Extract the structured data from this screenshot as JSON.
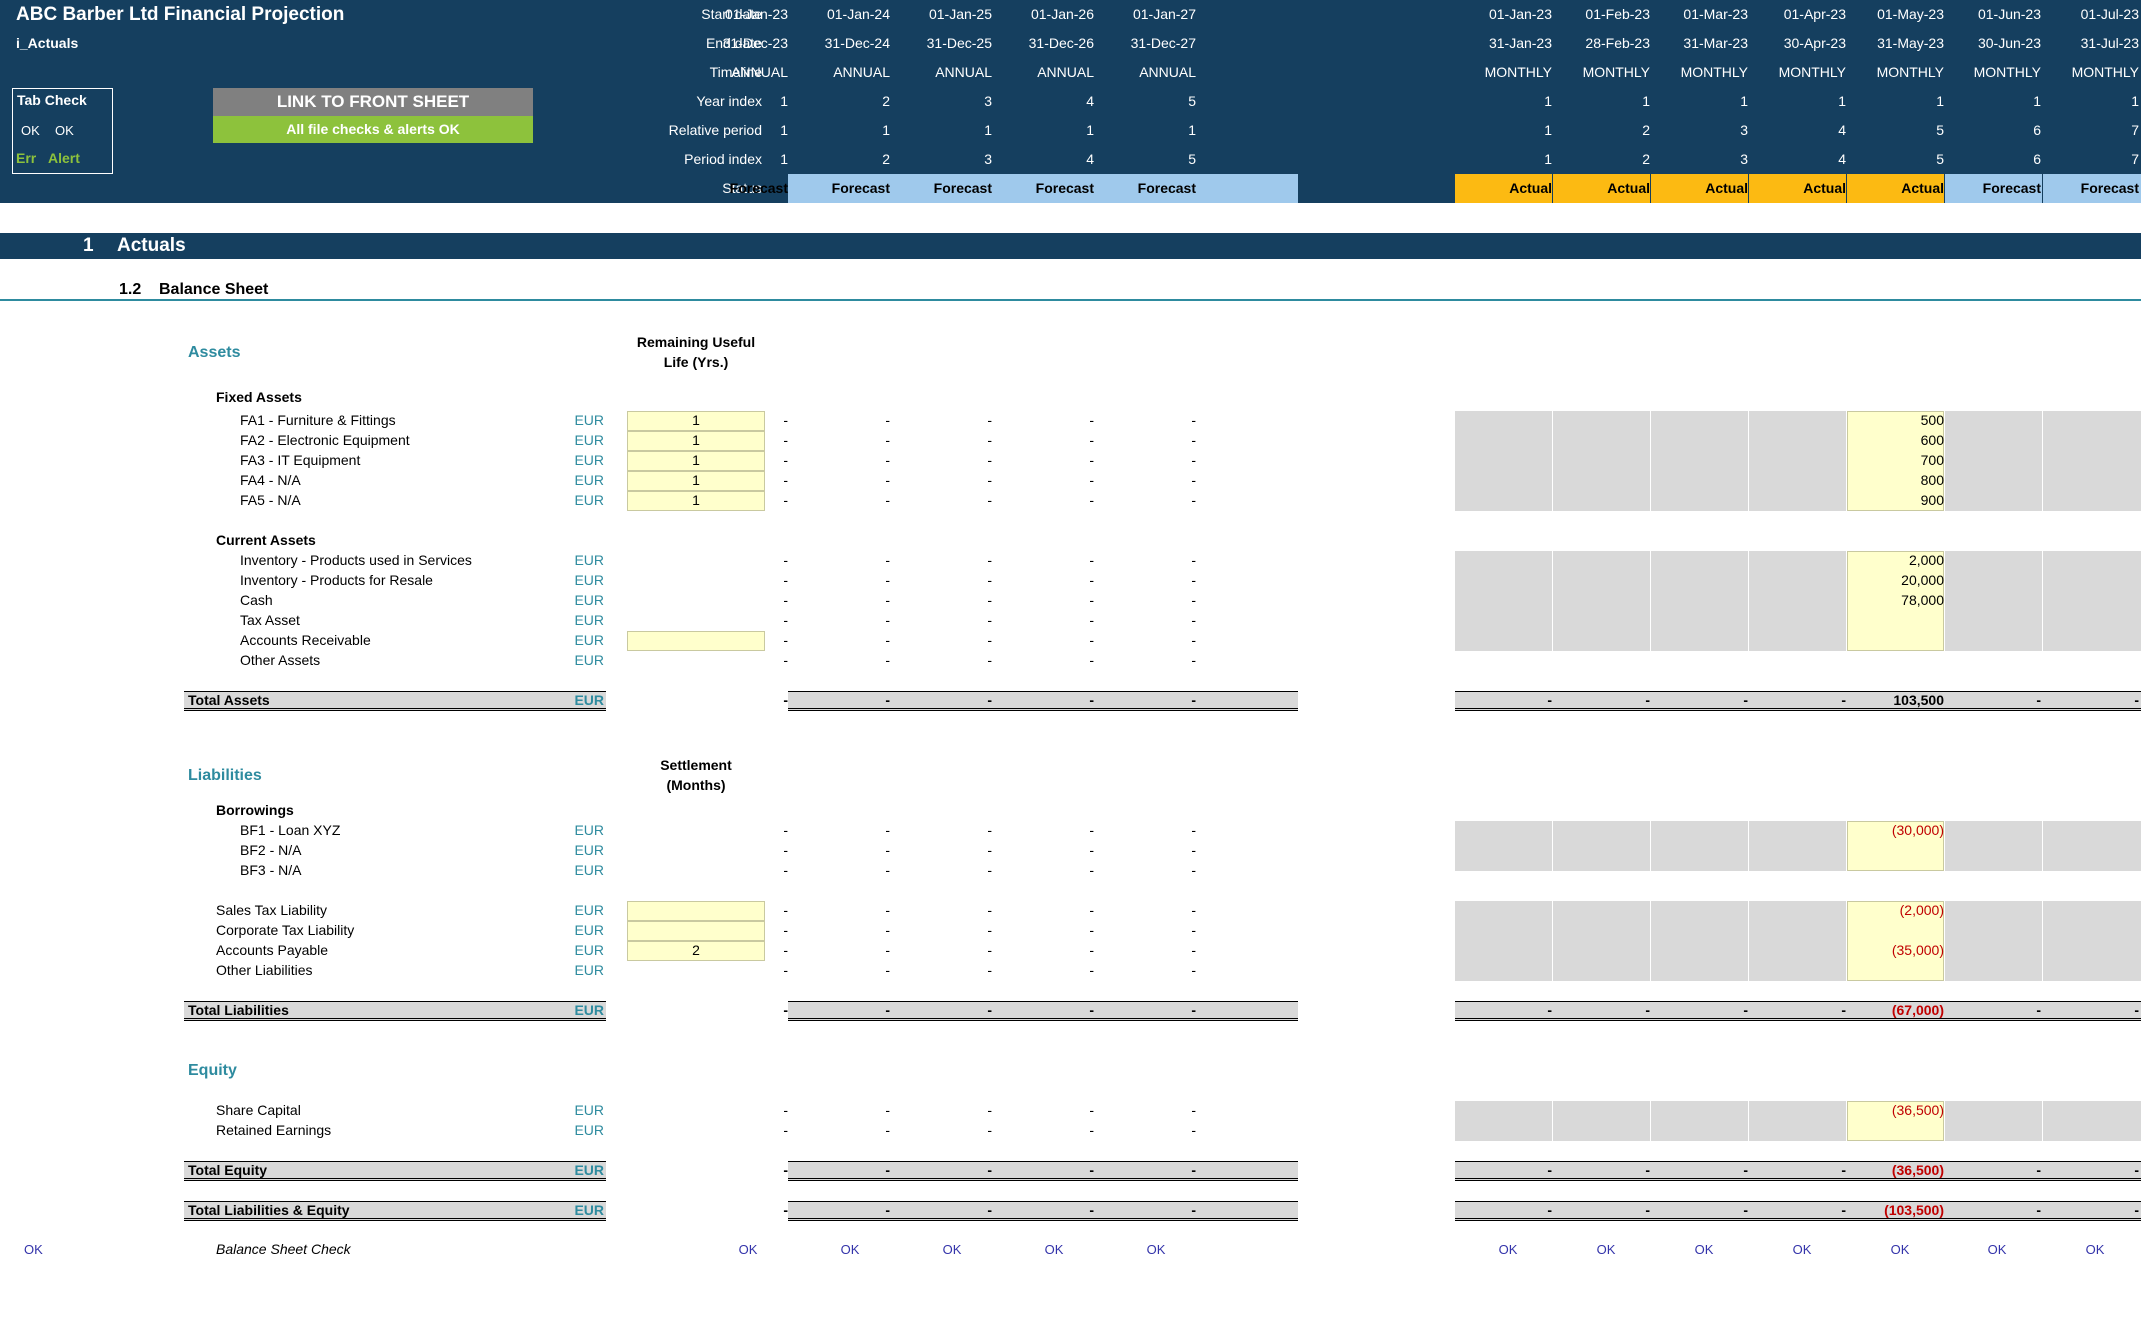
{
  "colors": {
    "header_bg": "#153f5f",
    "section_bg": "#153f5f",
    "forecast_bg": "#9fc9ec",
    "actual_bg": "#fcba12",
    "input_bg": "#ffffcc",
    "grey_cell": "#d9d9d9",
    "green_button": "#8dc23c",
    "grey_button": "#808080",
    "teal_text": "#2e8b9f",
    "neg_red": "#c00000",
    "ok_blue": "#3333aa"
  },
  "header": {
    "title": "ABC Barber Ltd Financial Projection",
    "sheet_name": "i_Actuals",
    "tab_check": {
      "title": "Tab Check",
      "ok1": "OK",
      "ok2": "OK",
      "err": "Err",
      "alert": "Alert"
    },
    "link_button": "LINK TO FRONT SHEET",
    "checks_banner": "All file checks & alerts OK",
    "row_labels": [
      "Start date",
      "End date",
      "Timeline",
      "Year index",
      "Relative period",
      "Period index",
      "Status"
    ],
    "annual": [
      {
        "start": "01-Jan-23",
        "end": "31-Dec-23",
        "timeline": "ANNUAL",
        "year": "1",
        "rel": "1",
        "period": "1",
        "status": "Forecast"
      },
      {
        "start": "01-Jan-24",
        "end": "31-Dec-24",
        "timeline": "ANNUAL",
        "year": "2",
        "rel": "1",
        "period": "2",
        "status": "Forecast"
      },
      {
        "start": "01-Jan-25",
        "end": "31-Dec-25",
        "timeline": "ANNUAL",
        "year": "3",
        "rel": "1",
        "period": "3",
        "status": "Forecast"
      },
      {
        "start": "01-Jan-26",
        "end": "31-Dec-26",
        "timeline": "ANNUAL",
        "year": "4",
        "rel": "1",
        "period": "4",
        "status": "Forecast"
      },
      {
        "start": "01-Jan-27",
        "end": "31-Dec-27",
        "timeline": "ANNUAL",
        "year": "5",
        "rel": "1",
        "period": "5",
        "status": "Forecast"
      }
    ],
    "monthly": [
      {
        "start": "01-Jan-23",
        "end": "31-Jan-23",
        "timeline": "MONTHLY",
        "year": "1",
        "rel": "1",
        "period": "1",
        "status": "Actual"
      },
      {
        "start": "01-Feb-23",
        "end": "28-Feb-23",
        "timeline": "MONTHLY",
        "year": "1",
        "rel": "2",
        "period": "2",
        "status": "Actual"
      },
      {
        "start": "01-Mar-23",
        "end": "31-Mar-23",
        "timeline": "MONTHLY",
        "year": "1",
        "rel": "3",
        "period": "3",
        "status": "Actual"
      },
      {
        "start": "01-Apr-23",
        "end": "30-Apr-23",
        "timeline": "MONTHLY",
        "year": "1",
        "rel": "4",
        "period": "4",
        "status": "Actual"
      },
      {
        "start": "01-May-23",
        "end": "31-May-23",
        "timeline": "MONTHLY",
        "year": "1",
        "rel": "5",
        "period": "5",
        "status": "Actual"
      },
      {
        "start": "01-Jun-23",
        "end": "30-Jun-23",
        "timeline": "MONTHLY",
        "year": "1",
        "rel": "6",
        "period": "6",
        "status": "Forecast"
      },
      {
        "start": "01-Jul-23",
        "end": "31-Jul-23",
        "timeline": "MONTHLY",
        "year": "1",
        "rel": "7",
        "period": "7",
        "status": "Forecast"
      }
    ]
  },
  "section": {
    "number": "1",
    "title": "Actuals",
    "sub_number": "1.2",
    "sub_title": "Balance Sheet"
  },
  "assets": {
    "title": "Assets",
    "col_header": [
      "Remaining Useful",
      "Life (Yrs.)"
    ],
    "fixed_title": "Fixed Assets",
    "current_title": "Current Assets",
    "fixed": [
      {
        "label": "FA1 - Furniture & Fittings",
        "unit": "EUR",
        "input": "1",
        "annual": [
          "-",
          "-",
          "-",
          "-",
          "-"
        ],
        "monthly": [
          "",
          "",
          "",
          "",
          "500",
          "",
          ""
        ]
      },
      {
        "label": "FA2 - Electronic Equipment",
        "unit": "EUR",
        "input": "1",
        "annual": [
          "-",
          "-",
          "-",
          "-",
          "-"
        ],
        "monthly": [
          "",
          "",
          "",
          "",
          "600",
          "",
          ""
        ]
      },
      {
        "label": "FA3 - IT Equipment",
        "unit": "EUR",
        "input": "1",
        "annual": [
          "-",
          "-",
          "-",
          "-",
          "-"
        ],
        "monthly": [
          "",
          "",
          "",
          "",
          "700",
          "",
          ""
        ]
      },
      {
        "label": "FA4 - N/A",
        "unit": "EUR",
        "input": "1",
        "annual": [
          "-",
          "-",
          "-",
          "-",
          "-"
        ],
        "monthly": [
          "",
          "",
          "",
          "",
          "800",
          "",
          ""
        ]
      },
      {
        "label": "FA5 - N/A",
        "unit": "EUR",
        "input": "1",
        "annual": [
          "-",
          "-",
          "-",
          "-",
          "-"
        ],
        "monthly": [
          "",
          "",
          "",
          "",
          "900",
          "",
          ""
        ]
      }
    ],
    "current": [
      {
        "label": "Inventory - Products used in Services",
        "unit": "EUR",
        "annual": [
          "-",
          "-",
          "-",
          "-",
          "-"
        ],
        "monthly": [
          "",
          "",
          "",
          "",
          "2,000",
          "",
          ""
        ]
      },
      {
        "label": "Inventory - Products for Resale",
        "unit": "EUR",
        "annual": [
          "-",
          "-",
          "-",
          "-",
          "-"
        ],
        "monthly": [
          "",
          "",
          "",
          "",
          "20,000",
          "",
          ""
        ]
      },
      {
        "label": "Cash",
        "unit": "EUR",
        "annual": [
          "-",
          "-",
          "-",
          "-",
          "-"
        ],
        "monthly": [
          "",
          "",
          "",
          "",
          "78,000",
          "",
          ""
        ]
      },
      {
        "label": "Tax Asset",
        "unit": "EUR",
        "annual": [
          "-",
          "-",
          "-",
          "-",
          "-"
        ],
        "monthly": [
          "",
          "",
          "",
          "",
          "",
          "",
          ""
        ]
      },
      {
        "label": "Accounts Receivable",
        "unit": "EUR",
        "input": "",
        "annual": [
          "-",
          "-",
          "-",
          "-",
          "-"
        ],
        "monthly": [
          "",
          "",
          "",
          "",
          "",
          "",
          ""
        ]
      },
      {
        "label": "Other Assets",
        "unit": "EUR",
        "annual": [
          "-",
          "-",
          "-",
          "-",
          "-"
        ],
        "monthly": [
          "",
          "",
          "",
          "",
          "",
          "",
          ""
        ]
      }
    ],
    "total": {
      "label": "Total Assets",
      "unit": "EUR",
      "annual": [
        "-",
        "-",
        "-",
        "-",
        "-"
      ],
      "monthly": [
        "-",
        "-",
        "-",
        "-",
        "103,500",
        "-",
        "-"
      ]
    }
  },
  "liabilities": {
    "title": "Liabilities",
    "col_header": [
      "Settlement",
      "(Months)"
    ],
    "borrowings_title": "Borrowings",
    "borrowings": [
      {
        "label": "BF1 - Loan XYZ",
        "unit": "EUR",
        "annual": [
          "-",
          "-",
          "-",
          "-",
          "-"
        ],
        "monthly": [
          "",
          "",
          "",
          "",
          "(30,000)",
          "",
          ""
        ]
      },
      {
        "label": "BF2 - N/A",
        "unit": "EUR",
        "annual": [
          "-",
          "-",
          "-",
          "-",
          "-"
        ],
        "monthly": [
          "",
          "",
          "",
          "",
          "",
          "",
          ""
        ]
      },
      {
        "label": "BF3 - N/A",
        "unit": "EUR",
        "annual": [
          "-",
          "-",
          "-",
          "-",
          "-"
        ],
        "monthly": [
          "",
          "",
          "",
          "",
          "",
          "",
          ""
        ]
      }
    ],
    "other": [
      {
        "label": "Sales Tax Liability",
        "unit": "EUR",
        "input": "",
        "annual": [
          "-",
          "-",
          "-",
          "-",
          "-"
        ],
        "monthly": [
          "",
          "",
          "",
          "",
          "(2,000)",
          "",
          ""
        ]
      },
      {
        "label": "Corporate Tax Liability",
        "unit": "EUR",
        "input": "",
        "annual": [
          "-",
          "-",
          "-",
          "-",
          "-"
        ],
        "monthly": [
          "",
          "",
          "",
          "",
          "",
          "",
          ""
        ]
      },
      {
        "label": "Accounts Payable",
        "unit": "EUR",
        "input": "2",
        "annual": [
          "-",
          "-",
          "-",
          "-",
          "-"
        ],
        "monthly": [
          "",
          "",
          "",
          "",
          "(35,000)",
          "",
          ""
        ]
      },
      {
        "label": "Other Liabilities",
        "unit": "EUR",
        "annual": [
          "-",
          "-",
          "-",
          "-",
          "-"
        ],
        "monthly": [
          "",
          "",
          "",
          "",
          "",
          "",
          ""
        ]
      }
    ],
    "total": {
      "label": "Total Liabilities",
      "unit": "EUR",
      "annual": [
        "-",
        "-",
        "-",
        "-",
        "-"
      ],
      "monthly": [
        "-",
        "-",
        "-",
        "-",
        "(67,000)",
        "-",
        "-"
      ]
    }
  },
  "equity": {
    "title": "Equity",
    "rows": [
      {
        "label": "Share Capital",
        "unit": "EUR",
        "annual": [
          "-",
          "-",
          "-",
          "-",
          "-"
        ],
        "monthly": [
          "",
          "",
          "",
          "",
          "(36,500)",
          "",
          ""
        ]
      },
      {
        "label": "Retained Earnings",
        "unit": "EUR",
        "annual": [
          "-",
          "-",
          "-",
          "-",
          "-"
        ],
        "monthly": [
          "",
          "",
          "",
          "",
          "",
          "",
          ""
        ]
      }
    ],
    "total": {
      "label": "Total Equity",
      "unit": "EUR",
      "annual": [
        "-",
        "-",
        "-",
        "-",
        "-"
      ],
      "monthly": [
        "-",
        "-",
        "-",
        "-",
        "(36,500)",
        "-",
        "-"
      ]
    },
    "total_le": {
      "label": "Total Liabilities & Equity",
      "unit": "EUR",
      "annual": [
        "-",
        "-",
        "-",
        "-",
        "-"
      ],
      "monthly": [
        "-",
        "-",
        "-",
        "-",
        "(103,500)",
        "-",
        "-"
      ]
    }
  },
  "check": {
    "left": "OK",
    "label": "Balance Sheet Check",
    "annual": [
      "OK",
      "OK",
      "OK",
      "OK",
      "OK"
    ],
    "monthly": [
      "OK",
      "OK",
      "OK",
      "OK",
      "OK",
      "OK",
      "OK"
    ]
  }
}
